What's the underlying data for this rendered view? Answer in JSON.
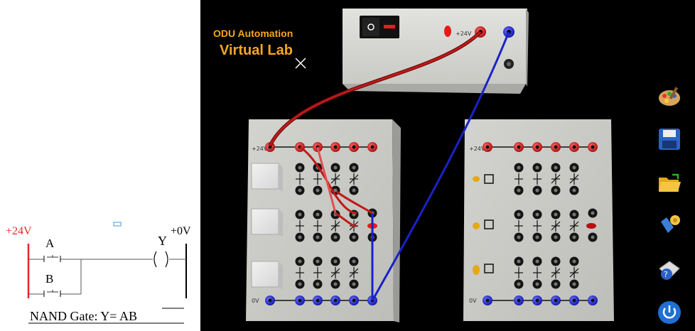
{
  "diagram": {
    "supply_label": "+24V",
    "contact_a_label": "A",
    "contact_b_label": "B",
    "coil_label": "Y",
    "ground_label": "+0V",
    "caption": "NAND Gate: Y= ",
    "caption_overline": "AB"
  },
  "lab": {
    "title_line1": "ODU Automation",
    "title_line2": "Virtual Lab",
    "power_supply_terminal_label": "+24V",
    "left_board": {
      "top_rail_label": "+24V",
      "bottom_rail_label": "0V"
    },
    "right_board": {
      "top_rail_label": "+24V",
      "bottom_rail_label": "0V"
    }
  },
  "toolbar": {
    "items": [
      {
        "name": "palette-icon",
        "tooltip": ""
      },
      {
        "name": "save-icon",
        "tooltip": ""
      },
      {
        "name": "open-folder-icon",
        "tooltip": ""
      },
      {
        "name": "settings-icon",
        "tooltip": ""
      },
      {
        "name": "help-icon",
        "tooltip": ""
      },
      {
        "name": "power-icon",
        "tooltip": ""
      }
    ]
  },
  "colors": {
    "title": "#f5a623",
    "positive_wire": "#c21818",
    "ground_wire": "#1a22c8",
    "panel": "#cfd0cb",
    "diagram_supply": "#e8272a"
  }
}
